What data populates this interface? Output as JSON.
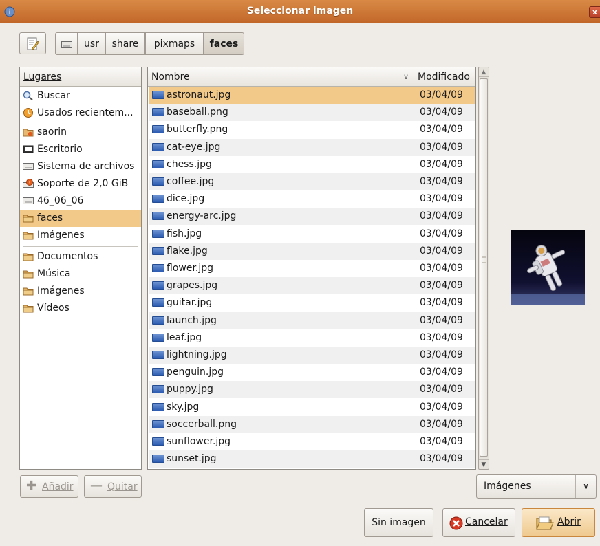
{
  "window": {
    "title": "Seleccionar imagen",
    "close_label": "x"
  },
  "path_bar": {
    "segments": [
      "usr",
      "share",
      "pixmaps",
      "faces"
    ],
    "active": "faces"
  },
  "places": {
    "header": "Lugares",
    "items": [
      {
        "label": "Buscar",
        "icon": "search-icon"
      },
      {
        "label": "Usados recientem...",
        "icon": "recent-icon"
      },
      {
        "label": "saorin",
        "icon": "home-folder-icon"
      },
      {
        "label": "Escritorio",
        "icon": "desktop-icon"
      },
      {
        "label": "Sistema de archivos",
        "icon": "drive-icon"
      },
      {
        "label": "Soporte de 2,0 GiB",
        "icon": "usb-drive-icon"
      },
      {
        "label": "46_06_06",
        "icon": "drive-icon"
      },
      {
        "label": "faces",
        "icon": "folder-icon",
        "selected": true
      },
      {
        "label": "Imágenes",
        "icon": "folder-icon"
      }
    ],
    "bookmarks": [
      {
        "label": "Documentos",
        "icon": "folder-icon"
      },
      {
        "label": "Música",
        "icon": "folder-icon"
      },
      {
        "label": "Imágenes",
        "icon": "folder-icon"
      },
      {
        "label": "Vídeos",
        "icon": "folder-icon"
      }
    ]
  },
  "files": {
    "name_header": "Nombre",
    "modified_header": "Modificado",
    "rows": [
      {
        "name": "astronaut.jpg",
        "date": "03/04/09",
        "selected": true
      },
      {
        "name": "baseball.png",
        "date": "03/04/09"
      },
      {
        "name": "butterfly.png",
        "date": "03/04/09"
      },
      {
        "name": "cat-eye.jpg",
        "date": "03/04/09"
      },
      {
        "name": "chess.jpg",
        "date": "03/04/09"
      },
      {
        "name": "coffee.jpg",
        "date": "03/04/09"
      },
      {
        "name": "dice.jpg",
        "date": "03/04/09"
      },
      {
        "name": "energy-arc.jpg",
        "date": "03/04/09"
      },
      {
        "name": "fish.jpg",
        "date": "03/04/09"
      },
      {
        "name": "flake.jpg",
        "date": "03/04/09"
      },
      {
        "name": "flower.jpg",
        "date": "03/04/09"
      },
      {
        "name": "grapes.jpg",
        "date": "03/04/09"
      },
      {
        "name": "guitar.jpg",
        "date": "03/04/09"
      },
      {
        "name": "launch.jpg",
        "date": "03/04/09"
      },
      {
        "name": "leaf.jpg",
        "date": "03/04/09"
      },
      {
        "name": "lightning.jpg",
        "date": "03/04/09"
      },
      {
        "name": "penguin.jpg",
        "date": "03/04/09"
      },
      {
        "name": "puppy.jpg",
        "date": "03/04/09"
      },
      {
        "name": "sky.jpg",
        "date": "03/04/09"
      },
      {
        "name": "soccerball.png",
        "date": "03/04/09"
      },
      {
        "name": "sunflower.jpg",
        "date": "03/04/09"
      },
      {
        "name": "sunset.jpg",
        "date": "03/04/09"
      }
    ]
  },
  "buttons": {
    "add_label": "Añadir",
    "remove_label": "Quitar",
    "no_image_label": "Sin imagen",
    "cancel_label": "Cancelar",
    "open_label": "Abrir"
  },
  "filter": {
    "value": "Imágenes"
  },
  "colors": {
    "titlebar": "#c96f30",
    "selection": "#f3c98a",
    "accent": "#f0b66a"
  }
}
